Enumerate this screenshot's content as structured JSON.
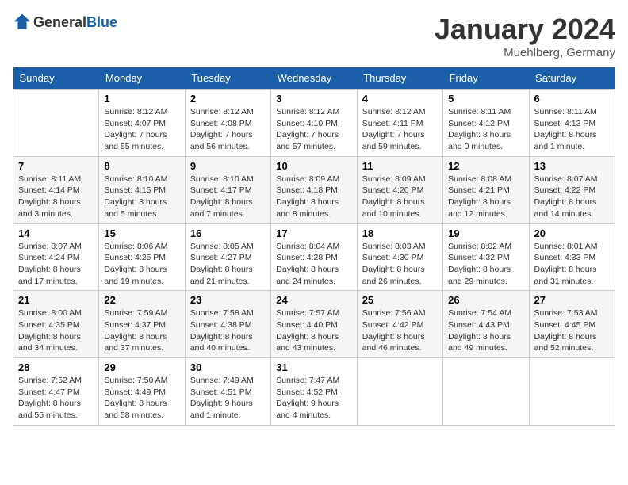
{
  "header": {
    "logo_general": "General",
    "logo_blue": "Blue",
    "month_title": "January 2024",
    "location": "Muehlberg, Germany"
  },
  "days_of_week": [
    "Sunday",
    "Monday",
    "Tuesday",
    "Wednesday",
    "Thursday",
    "Friday",
    "Saturday"
  ],
  "weeks": [
    [
      {
        "day": "",
        "info": ""
      },
      {
        "day": "1",
        "info": "Sunrise: 8:12 AM\nSunset: 4:07 PM\nDaylight: 7 hours\nand 55 minutes."
      },
      {
        "day": "2",
        "info": "Sunrise: 8:12 AM\nSunset: 4:08 PM\nDaylight: 7 hours\nand 56 minutes."
      },
      {
        "day": "3",
        "info": "Sunrise: 8:12 AM\nSunset: 4:10 PM\nDaylight: 7 hours\nand 57 minutes."
      },
      {
        "day": "4",
        "info": "Sunrise: 8:12 AM\nSunset: 4:11 PM\nDaylight: 7 hours\nand 59 minutes."
      },
      {
        "day": "5",
        "info": "Sunrise: 8:11 AM\nSunset: 4:12 PM\nDaylight: 8 hours\nand 0 minutes."
      },
      {
        "day": "6",
        "info": "Sunrise: 8:11 AM\nSunset: 4:13 PM\nDaylight: 8 hours\nand 1 minute."
      }
    ],
    [
      {
        "day": "7",
        "info": "Sunrise: 8:11 AM\nSunset: 4:14 PM\nDaylight: 8 hours\nand 3 minutes."
      },
      {
        "day": "8",
        "info": "Sunrise: 8:10 AM\nSunset: 4:15 PM\nDaylight: 8 hours\nand 5 minutes."
      },
      {
        "day": "9",
        "info": "Sunrise: 8:10 AM\nSunset: 4:17 PM\nDaylight: 8 hours\nand 7 minutes."
      },
      {
        "day": "10",
        "info": "Sunrise: 8:09 AM\nSunset: 4:18 PM\nDaylight: 8 hours\nand 8 minutes."
      },
      {
        "day": "11",
        "info": "Sunrise: 8:09 AM\nSunset: 4:20 PM\nDaylight: 8 hours\nand 10 minutes."
      },
      {
        "day": "12",
        "info": "Sunrise: 8:08 AM\nSunset: 4:21 PM\nDaylight: 8 hours\nand 12 minutes."
      },
      {
        "day": "13",
        "info": "Sunrise: 8:07 AM\nSunset: 4:22 PM\nDaylight: 8 hours\nand 14 minutes."
      }
    ],
    [
      {
        "day": "14",
        "info": "Sunrise: 8:07 AM\nSunset: 4:24 PM\nDaylight: 8 hours\nand 17 minutes."
      },
      {
        "day": "15",
        "info": "Sunrise: 8:06 AM\nSunset: 4:25 PM\nDaylight: 8 hours\nand 19 minutes."
      },
      {
        "day": "16",
        "info": "Sunrise: 8:05 AM\nSunset: 4:27 PM\nDaylight: 8 hours\nand 21 minutes."
      },
      {
        "day": "17",
        "info": "Sunrise: 8:04 AM\nSunset: 4:28 PM\nDaylight: 8 hours\nand 24 minutes."
      },
      {
        "day": "18",
        "info": "Sunrise: 8:03 AM\nSunset: 4:30 PM\nDaylight: 8 hours\nand 26 minutes."
      },
      {
        "day": "19",
        "info": "Sunrise: 8:02 AM\nSunset: 4:32 PM\nDaylight: 8 hours\nand 29 minutes."
      },
      {
        "day": "20",
        "info": "Sunrise: 8:01 AM\nSunset: 4:33 PM\nDaylight: 8 hours\nand 31 minutes."
      }
    ],
    [
      {
        "day": "21",
        "info": "Sunrise: 8:00 AM\nSunset: 4:35 PM\nDaylight: 8 hours\nand 34 minutes."
      },
      {
        "day": "22",
        "info": "Sunrise: 7:59 AM\nSunset: 4:37 PM\nDaylight: 8 hours\nand 37 minutes."
      },
      {
        "day": "23",
        "info": "Sunrise: 7:58 AM\nSunset: 4:38 PM\nDaylight: 8 hours\nand 40 minutes."
      },
      {
        "day": "24",
        "info": "Sunrise: 7:57 AM\nSunset: 4:40 PM\nDaylight: 8 hours\nand 43 minutes."
      },
      {
        "day": "25",
        "info": "Sunrise: 7:56 AM\nSunset: 4:42 PM\nDaylight: 8 hours\nand 46 minutes."
      },
      {
        "day": "26",
        "info": "Sunrise: 7:54 AM\nSunset: 4:43 PM\nDaylight: 8 hours\nand 49 minutes."
      },
      {
        "day": "27",
        "info": "Sunrise: 7:53 AM\nSunset: 4:45 PM\nDaylight: 8 hours\nand 52 minutes."
      }
    ],
    [
      {
        "day": "28",
        "info": "Sunrise: 7:52 AM\nSunset: 4:47 PM\nDaylight: 8 hours\nand 55 minutes."
      },
      {
        "day": "29",
        "info": "Sunrise: 7:50 AM\nSunset: 4:49 PM\nDaylight: 8 hours\nand 58 minutes."
      },
      {
        "day": "30",
        "info": "Sunrise: 7:49 AM\nSunset: 4:51 PM\nDaylight: 9 hours\nand 1 minute."
      },
      {
        "day": "31",
        "info": "Sunrise: 7:47 AM\nSunset: 4:52 PM\nDaylight: 9 hours\nand 4 minutes."
      },
      {
        "day": "",
        "info": ""
      },
      {
        "day": "",
        "info": ""
      },
      {
        "day": "",
        "info": ""
      }
    ]
  ]
}
